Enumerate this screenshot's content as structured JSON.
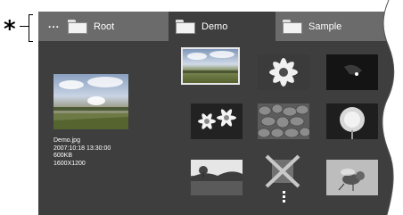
{
  "callout": {
    "marker": "*"
  },
  "breadcrumb": {
    "ellipsis": "...",
    "items": [
      {
        "label": "Root",
        "active": false
      },
      {
        "label": "Demo",
        "active": true
      },
      {
        "label": "Sample",
        "active": false
      }
    ]
  },
  "preview": {
    "filename": "Demo.jpg",
    "datetime": "2007:10:18 13:30:00",
    "filesize": "600KB",
    "resolution": "1600X1200"
  },
  "thumbnails": [
    {
      "subject": "landscape",
      "selected": true
    },
    {
      "subject": "white-flower",
      "selected": false
    },
    {
      "subject": "dark-night",
      "selected": false
    },
    {
      "subject": "daisies",
      "selected": false
    },
    {
      "subject": "pebbles",
      "selected": false
    },
    {
      "subject": "dandelion",
      "selected": false
    },
    {
      "subject": "tree-hills",
      "selected": false
    },
    {
      "subject": "broken-file",
      "selected": false
    },
    {
      "subject": "insect",
      "selected": false
    }
  ],
  "colors": {
    "panel": "#3e3e3e",
    "bar": "#6b6b6b",
    "text": "#ffffff"
  }
}
